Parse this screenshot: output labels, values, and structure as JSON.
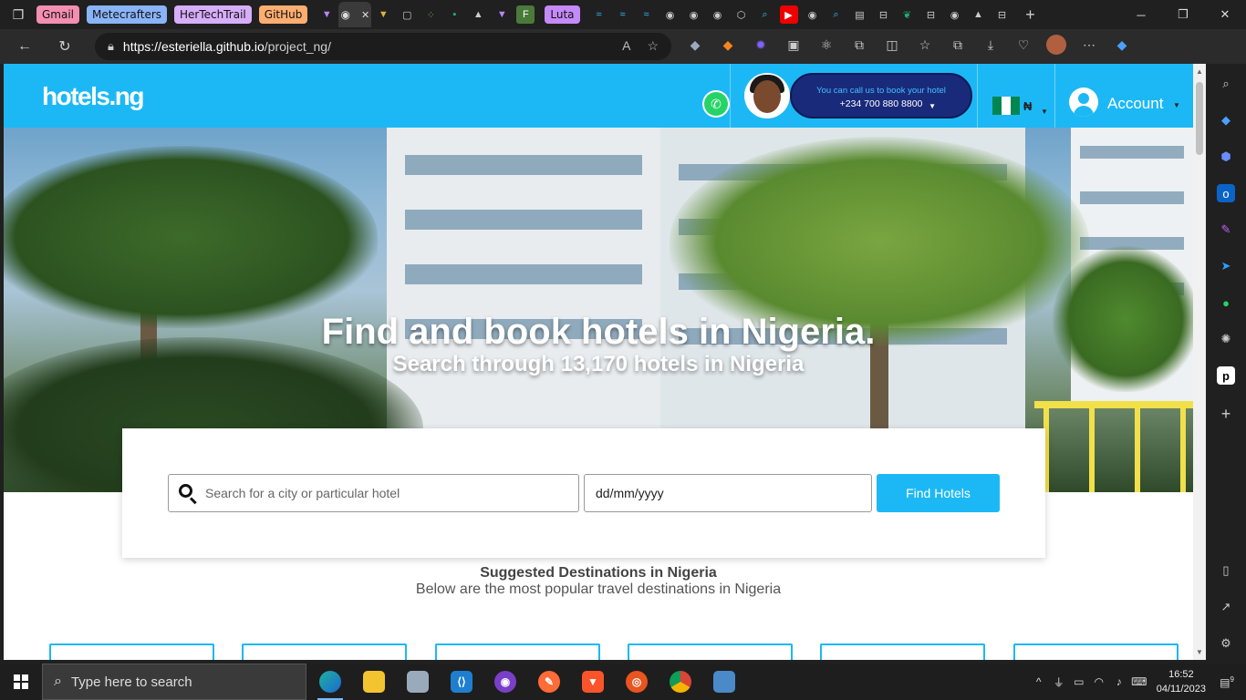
{
  "browser": {
    "tab_groups": [
      {
        "label": "Gmail",
        "color": "#f48fb1"
      },
      {
        "label": "Metecrafters",
        "color": "#8ab4f8"
      },
      {
        "label": "HerTechTrail",
        "color": "#d7aefb"
      },
      {
        "label": "GitHub",
        "color": "#fcad70"
      },
      {
        "label": "Luta",
        "color": "#c58af9"
      }
    ],
    "url_host": "https://esteriella.github.io",
    "url_path": "/project_ng/"
  },
  "site": {
    "logo_text": "hotels.ng",
    "call_prompt": "You can call us to book your hotel",
    "call_number": "+234 700 880 8800",
    "currency_symbol": "₦",
    "account_label": "Account",
    "brand_color": "#1cb8f5"
  },
  "hero": {
    "title": "Find and book hotels in Nigeria.",
    "subtitle": "Search through 13,170 hotels in Nigeria"
  },
  "search": {
    "query_placeholder": "Search for a city or particular hotel",
    "date_placeholder": "dd/mm/yyyy",
    "button_label": "Find Hotels"
  },
  "suggested": {
    "title": "Suggested Destinations in Nigeria",
    "subtitle": "Below are the most popular travel destinations in Nigeria",
    "card_count": 6
  },
  "taskbar": {
    "search_placeholder": "Type here to search",
    "time": "16:52",
    "date": "04/11/2023",
    "notification_count": "9"
  }
}
